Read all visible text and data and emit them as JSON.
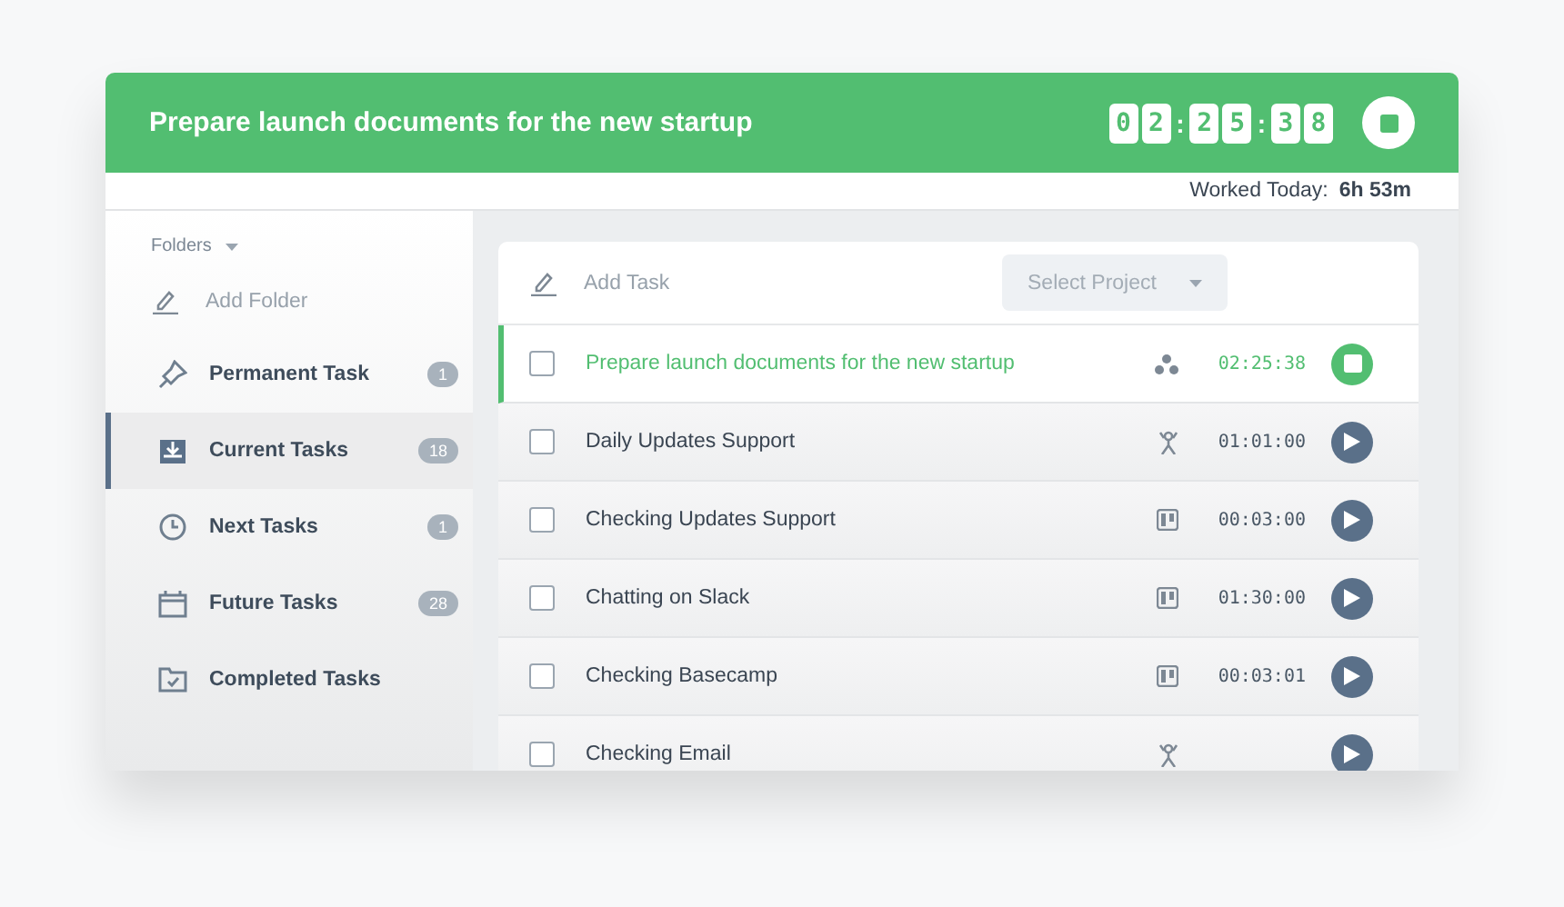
{
  "header": {
    "title": "Prepare launch documents for the new startup",
    "timer": [
      {
        "kind": "digit",
        "text": "0"
      },
      {
        "kind": "digit",
        "text": "2"
      },
      {
        "kind": "sep",
        "text": ":"
      },
      {
        "kind": "digit",
        "text": "2"
      },
      {
        "kind": "digit",
        "text": "5"
      },
      {
        "kind": "sep",
        "text": ":"
      },
      {
        "kind": "digit",
        "text": "3"
      },
      {
        "kind": "digit",
        "text": "8"
      }
    ],
    "running": true
  },
  "worked_today": {
    "label": "Worked Today:",
    "value": "6h 53m"
  },
  "sidebar": {
    "folders_label": "Folders",
    "add_folder": "Add Folder",
    "items": [
      {
        "label": "Permanent Task",
        "count": "1",
        "selected": false
      },
      {
        "label": "Current Tasks",
        "count": "18",
        "selected": true
      },
      {
        "label": "Next Tasks",
        "count": "1",
        "selected": false
      },
      {
        "label": "Future Tasks",
        "count": "28",
        "selected": false
      },
      {
        "label": "Completed Tasks",
        "selected": false
      }
    ]
  },
  "task_list": {
    "add_task": "Add Task",
    "project_select": {
      "placeholder": "Select Project"
    },
    "tasks": [
      {
        "name": "Prepare launch documents for the new startup",
        "checked": false,
        "time": "02:25:38",
        "running": true
      },
      {
        "name": "Daily Updates Support",
        "checked": false,
        "time": "01:01:00",
        "running": false
      },
      {
        "name": "Checking Updates Support",
        "checked": false,
        "time": "00:03:00",
        "running": false
      },
      {
        "name": "Chatting on Slack",
        "checked": false,
        "time": "01:30:00",
        "running": false
      },
      {
        "name": "Checking Basecamp",
        "checked": false,
        "time": "00:03:01",
        "running": false
      },
      {
        "name": "Checking Email",
        "checked": false,
        "running": false
      }
    ]
  }
}
